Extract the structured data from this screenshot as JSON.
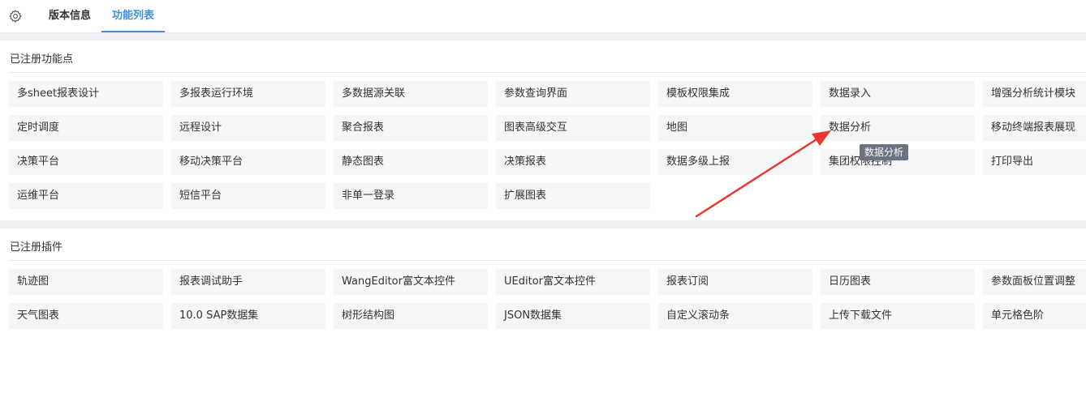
{
  "tabs": [
    {
      "label": "版本信息",
      "active": false
    },
    {
      "label": "功能列表",
      "active": true
    }
  ],
  "features": {
    "title": "已注册功能点",
    "items": [
      "多sheet报表设计",
      "多报表运行环境",
      "多数据源关联",
      "参数查询界面",
      "模板权限集成",
      "数据录入",
      "增强分析统计模块",
      "定时调度",
      "远程设计",
      "聚合报表",
      "图表高级交互",
      "地图",
      "数据分析",
      "移动终端报表展现",
      "决策平台",
      "移动决策平台",
      "静态图表",
      "决策报表",
      "数据多级上报",
      "集团权限控制",
      "打印导出",
      "运维平台",
      "短信平台",
      "非单一登录",
      "扩展图表"
    ]
  },
  "plugins": {
    "title": "已注册插件",
    "items": [
      "轨迹图",
      "报表调试助手",
      "WangEditor富文本控件",
      "UEditor富文本控件",
      "报表订阅",
      "日历图表",
      "参数面板位置调整",
      "天气图表",
      "10.0 SAP数据集",
      "树形结构图",
      "JSON数据集",
      "自定义滚动条",
      "上传下载文件",
      "单元格色阶"
    ]
  },
  "tooltip": {
    "text": "数据分析"
  },
  "colors": {
    "accent": "#3d8ee8",
    "arrow": "#e8382f",
    "item_bg": "#f5f6f8"
  },
  "icons": {
    "settings": "gear-icon"
  }
}
